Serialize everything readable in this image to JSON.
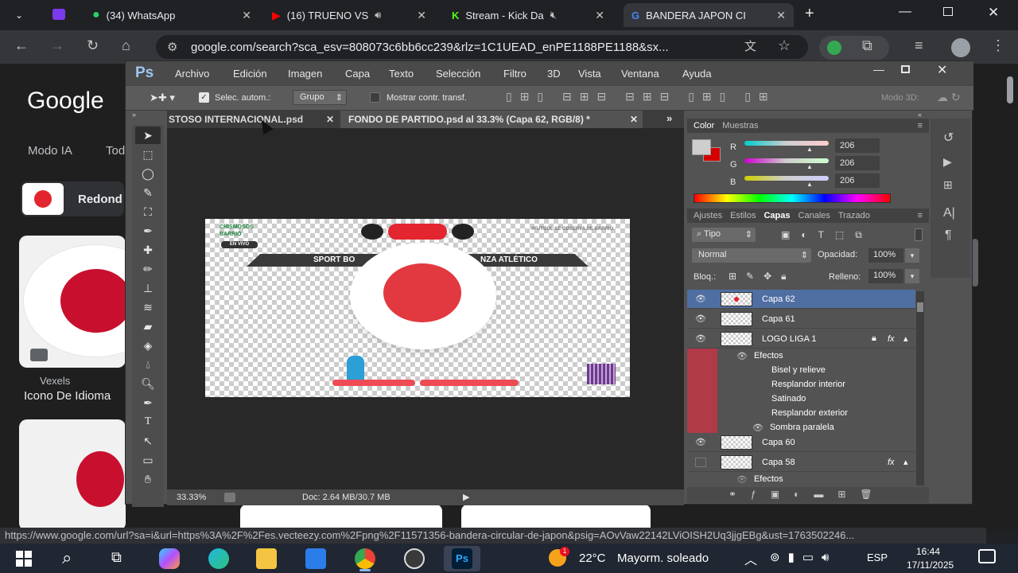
{
  "browser": {
    "tabs": [
      {
        "label": "(34) WhatsApp"
      },
      {
        "label": "(16) TRUENO VS"
      },
      {
        "label": "Stream - Kick Da"
      },
      {
        "label": "BANDERA JAPON CI"
      }
    ],
    "url": "google.com/search?sca_esv=808073c6bb6cc239&rlz=1C1UEAD_enPE1188PE1188&sx...",
    "status_url": "https://www.google.com/url?sa=i&url=https%3A%2F%2Fes.vecteezy.com%2Fpng%2F11571356-bandera-circular-de-japon&psig=AOvVaw22142LViOISH2Uq3jjgEBg&ust=1763502246..."
  },
  "google": {
    "logo": "Google",
    "nav_modo_ia": "Modo IA",
    "nav_todo": "Tod",
    "card_title": "Redond",
    "source_name": "Vexels",
    "source_title": "Icono De Idioma"
  },
  "photoshop": {
    "logo": "Ps",
    "menu": [
      "Archivo",
      "Edición",
      "Imagen",
      "Capa",
      "Texto",
      "Selección",
      "Filtro",
      "3D",
      "Vista",
      "Ventana",
      "Ayuda"
    ],
    "options": {
      "auto_select": "Selec. autom.:",
      "group_select": "Grupo",
      "show_transform": "Mostrar contr. transf.",
      "mode3d": "Modo 3D:"
    },
    "doc_tabs": [
      {
        "label": "STOSO INTERNACIONAL.psd"
      },
      {
        "label": "FONDO DE PARTIDO.psd al 33.3% (Capa 62, RGB/8) *"
      }
    ],
    "zoom": "33.33%",
    "doc_info": "Doc: 2.64 MB/30.7 MB",
    "color_panel": {
      "tabs": [
        "Color",
        "Muestras"
      ],
      "r_label": "R",
      "g_label": "G",
      "b_label": "B",
      "r": "206",
      "g": "206",
      "b": "206"
    },
    "layers_panel": {
      "tabs": [
        "Ajustes",
        "Estilos",
        "Capas",
        "Canales",
        "Trazado"
      ],
      "kind_filter": "Tipo",
      "blend_mode": "Normal",
      "opacity_label": "Opacidad:",
      "opacity": "100%",
      "lock_label": "Bloq.:",
      "fill_label": "Relleno:",
      "fill": "100%",
      "layers": [
        {
          "name": "Capa 62"
        },
        {
          "name": "Capa 61"
        },
        {
          "name": "LOGO LIGA 1"
        },
        {
          "name": "Capa 60"
        },
        {
          "name": "Capa 58"
        }
      ],
      "effects_label": "Efectos",
      "effects": [
        "Bisel y relieve",
        "Resplandor interior",
        "Satinado",
        "Resplandor exterior",
        "Sombra paralela"
      ],
      "effects2_label": "Efectos"
    },
    "canvas_text": {
      "banner_left": "SPORT BO",
      "banner_right": "NZA ATLÉTICO",
      "en_vivo": "EN VIVO",
      "logo_top": "CHISMOSOS",
      "logo_bottom": "BARRIO",
      "handle": "#FUTBOL SE OBSERVA DE BARRIO"
    }
  },
  "taskbar": {
    "weather_temp": "22°C",
    "weather_desc": "Mayorm. soleado",
    "lang": "ESP",
    "time": "16:44",
    "date": "17/11/2025",
    "notif_count": "1"
  },
  "colors": {
    "ps_bg": "#535353",
    "red": "#e2252e",
    "chrome_dark": "#202124",
    "selected_layer": "#4f6ea2",
    "effects_bar": "#b03a47"
  }
}
